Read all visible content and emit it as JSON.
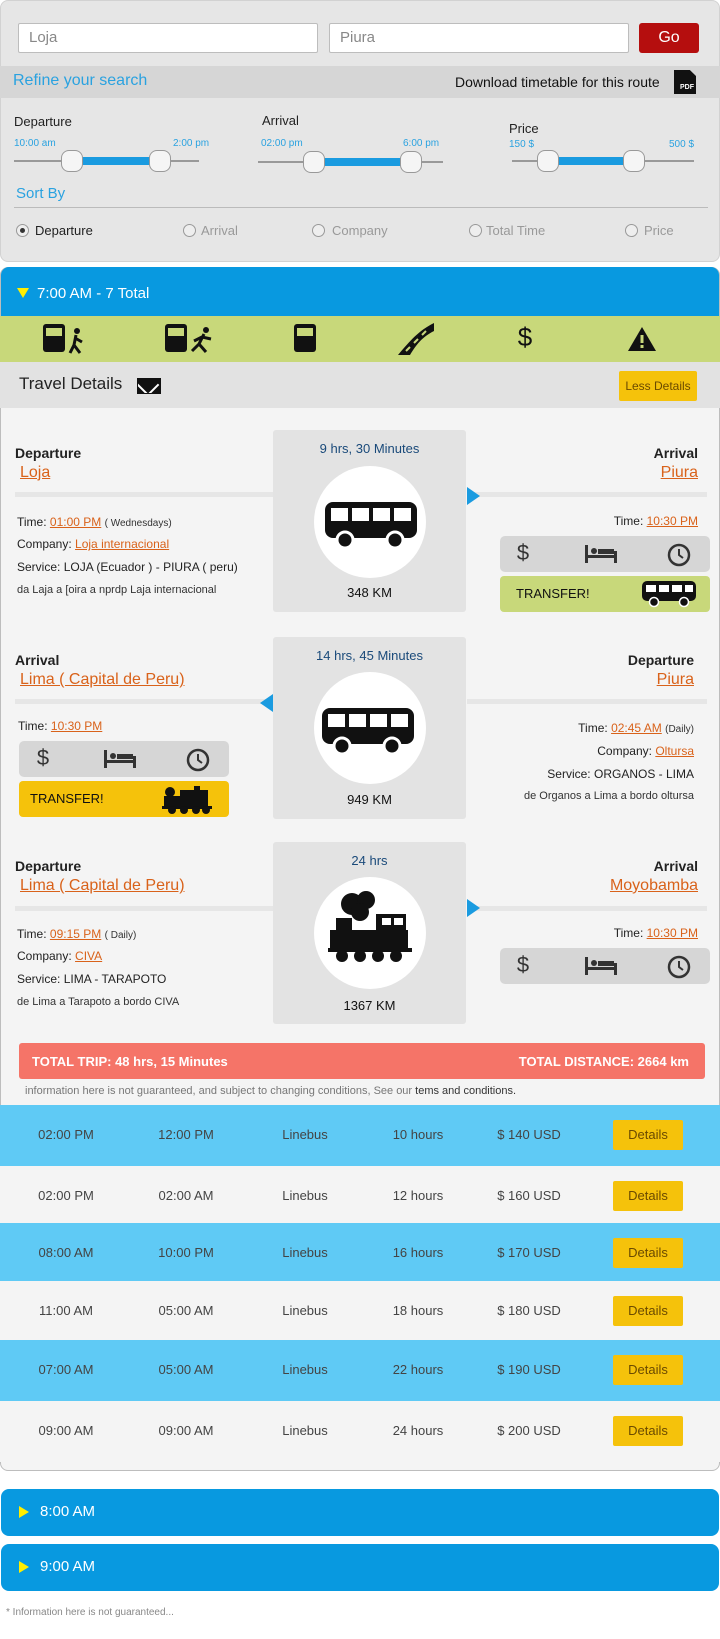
{
  "search": {
    "from_placeholder": "Loja",
    "to_placeholder": "Piura",
    "go_label": "Go",
    "refine_title": "Refine your search",
    "download_label": "Download timetable for this route",
    "pdf_label": "PDF"
  },
  "filters": {
    "departure": {
      "label": "Departure",
      "min": "10:00 am",
      "max": "2:00 pm",
      "range": [
        0.2,
        0.8
      ]
    },
    "arrival": {
      "label": "Arrival",
      "min": "02:00 pm",
      "max": "6:00 pm",
      "range": [
        0.3,
        0.8
      ]
    },
    "price": {
      "label": "Price",
      "min": "150 $",
      "max": "500 $",
      "range": [
        0.2,
        0.7
      ]
    }
  },
  "sort": {
    "title": "Sort By",
    "options": [
      "Departure",
      "Arrival",
      "Company",
      "Total Time",
      "Price"
    ],
    "selected": "Departure"
  },
  "group_open": {
    "label": "7:00 AM - 7 Total"
  },
  "strip_icons": [
    "bus-walking-icon",
    "bus-running-icon",
    "bus-icon",
    "road-icon",
    "dollar-icon",
    "warning-icon"
  ],
  "travel_details": {
    "title": "Travel Details",
    "less_label": "Less Details"
  },
  "legs": [
    {
      "duration": "9 hrs, 30 Minutes",
      "km": "348 KM",
      "left_head": "Departure",
      "left_place": "Loja",
      "right_head": "Arrival",
      "right_place": "Piura",
      "time_label": "Time:",
      "dep_time": "01:00 PM",
      "dep_freq": "( Wednesdays)",
      "company_label": "Company:",
      "company": "Loja internacional",
      "service_label": "Service:",
      "service": "LOJA (Ecuador ) - PIURA ( peru)",
      "note": "da Laja a [oira a nprdp Laja internacional",
      "arr_time": "10:30 PM",
      "transfer": "TRANSFER!"
    },
    {
      "duration": "14 hrs, 45 Minutes",
      "km": "949 KM",
      "left_head": "Arrival",
      "left_place": "Lima ( Capital de Peru)",
      "right_head": "Departure",
      "right_place": "Piura",
      "time_label": "Time:",
      "arr_time": "10:30 PM",
      "transfer": "TRANSFER!",
      "dep_time": "02:45 AM",
      "dep_freq": "(Daily)",
      "company_label": "Company:",
      "company": "Oltursa",
      "service_label": "Service:",
      "service": "ORGANOS - LIMA",
      "note": "de Organos a Lima a bordo oltursa"
    },
    {
      "duration": "24 hrs",
      "km": "1367 KM",
      "left_head": "Departure",
      "left_place": "Lima ( Capital de Peru)",
      "right_head": "Arrival",
      "right_place": "Moyobamba",
      "time_label": "Time:",
      "dep_time": "09:15 PM",
      "dep_freq": "( Daily)",
      "company_label": "Company:",
      "company": "CIVA",
      "service_label": "Service:",
      "service": "LIMA - TARAPOTO",
      "note": "de Lima a Tarapoto a bordo CIVA",
      "arr_time": "10:30 PM"
    }
  ],
  "totals": {
    "trip_label": "TOTAL TRIP:",
    "trip_value": "48 hrs, 15 Minutes",
    "distance_label": "TOTAL DISTANCE:",
    "distance_value": "2664 km"
  },
  "disclaimer": {
    "text": "information here is not guaranteed, and subject to changing conditions,  See our",
    "link": "tems and conditions."
  },
  "rows": [
    {
      "dep": "02:00 PM",
      "arr": "12:00 PM",
      "company": "Linebus",
      "duration": "10 hours",
      "price": "$ 140 USD",
      "button": "Details"
    },
    {
      "dep": "02:00 PM",
      "arr": "02:00 AM",
      "company": "Linebus",
      "duration": "12 hours",
      "price": "$ 160 USD",
      "button": "Details"
    },
    {
      "dep": "08:00 AM",
      "arr": "10:00 PM",
      "company": "Linebus",
      "duration": "16 hours",
      "price": "$ 170 USD",
      "button": "Details"
    },
    {
      "dep": "11:00 AM",
      "arr": "05:00 AM",
      "company": "Linebus",
      "duration": "18 hours",
      "price": "$ 180 USD",
      "button": "Details"
    },
    {
      "dep": "07:00 AM",
      "arr": "05:00 AM",
      "company": "Linebus",
      "duration": "22 hours",
      "price": "$ 190 USD",
      "button": "Details"
    },
    {
      "dep": "09:00 AM",
      "arr": "09:00 AM",
      "company": "Linebus",
      "duration": "24 hours",
      "price": "$ 200 USD",
      "button": "Details"
    }
  ],
  "groups_closed": [
    {
      "label": "8:00 AM"
    },
    {
      "label": "9:00 AM"
    }
  ],
  "footer": "* Information here is not guaranteed..."
}
